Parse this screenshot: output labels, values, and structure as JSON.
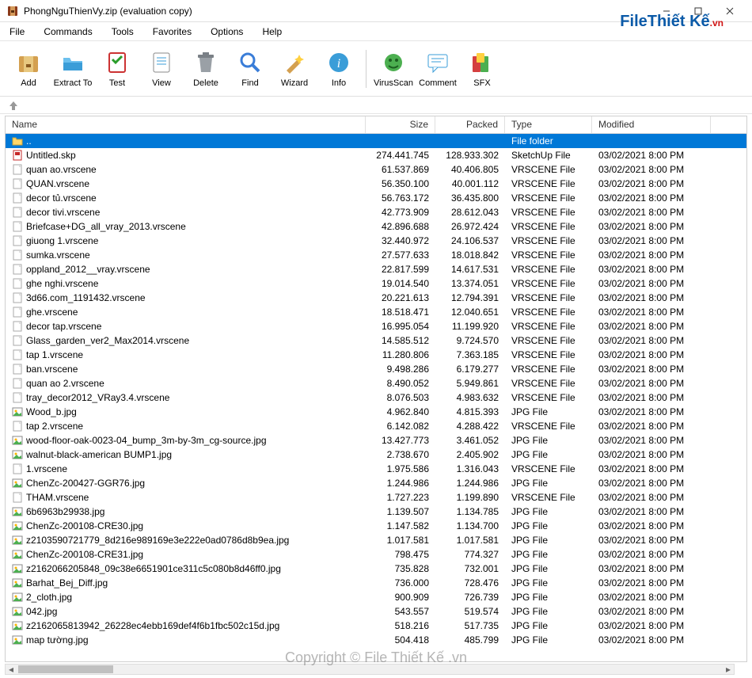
{
  "window": {
    "title": "PhongNguThienVy.zip (evaluation copy)"
  },
  "menu": [
    "File",
    "Commands",
    "Tools",
    "Favorites",
    "Options",
    "Help"
  ],
  "toolbar": [
    {
      "id": "add",
      "label": "Add"
    },
    {
      "id": "extract",
      "label": "Extract To"
    },
    {
      "id": "test",
      "label": "Test"
    },
    {
      "id": "view",
      "label": "View"
    },
    {
      "id": "delete",
      "label": "Delete"
    },
    {
      "id": "find",
      "label": "Find"
    },
    {
      "id": "wizard",
      "label": "Wizard"
    },
    {
      "id": "info",
      "label": "Info"
    },
    {
      "id": "sep"
    },
    {
      "id": "virus",
      "label": "VirusScan"
    },
    {
      "id": "comment",
      "label": "Comment"
    },
    {
      "id": "sfx",
      "label": "SFX"
    }
  ],
  "columns": {
    "name": "Name",
    "size": "Size",
    "packed": "Packed",
    "type": "Type",
    "modified": "Modified"
  },
  "parent_row": {
    "name": "..",
    "type": "File folder"
  },
  "files": [
    {
      "name": "Untitled.skp",
      "size": "274.441.745",
      "packed": "128.933.302",
      "type": "SketchUp File",
      "modified": "03/02/2021 8:00 PM",
      "icon": "skp"
    },
    {
      "name": "quan ao.vrscene",
      "size": "61.537.869",
      "packed": "40.406.805",
      "type": "VRSCENE File",
      "modified": "03/02/2021 8:00 PM",
      "icon": "doc"
    },
    {
      "name": "QUAN.vrscene",
      "size": "56.350.100",
      "packed": "40.001.112",
      "type": "VRSCENE File",
      "modified": "03/02/2021 8:00 PM",
      "icon": "doc"
    },
    {
      "name": "decor tủ.vrscene",
      "size": "56.763.172",
      "packed": "36.435.800",
      "type": "VRSCENE File",
      "modified": "03/02/2021 8:00 PM",
      "icon": "doc"
    },
    {
      "name": "decor tivi.vrscene",
      "size": "42.773.909",
      "packed": "28.612.043",
      "type": "VRSCENE File",
      "modified": "03/02/2021 8:00 PM",
      "icon": "doc"
    },
    {
      "name": "Briefcase+DG_all_vray_2013.vrscene",
      "size": "42.896.688",
      "packed": "26.972.424",
      "type": "VRSCENE File",
      "modified": "03/02/2021 8:00 PM",
      "icon": "doc"
    },
    {
      "name": "giuong 1.vrscene",
      "size": "32.440.972",
      "packed": "24.106.537",
      "type": "VRSCENE File",
      "modified": "03/02/2021 8:00 PM",
      "icon": "doc"
    },
    {
      "name": "sumka.vrscene",
      "size": "27.577.633",
      "packed": "18.018.842",
      "type": "VRSCENE File",
      "modified": "03/02/2021 8:00 PM",
      "icon": "doc"
    },
    {
      "name": "oppland_2012__vray.vrscene",
      "size": "22.817.599",
      "packed": "14.617.531",
      "type": "VRSCENE File",
      "modified": "03/02/2021 8:00 PM",
      "icon": "doc"
    },
    {
      "name": "ghe nghi.vrscene",
      "size": "19.014.540",
      "packed": "13.374.051",
      "type": "VRSCENE File",
      "modified": "03/02/2021 8:00 PM",
      "icon": "doc"
    },
    {
      "name": "3d66.com_1191432.vrscene",
      "size": "20.221.613",
      "packed": "12.794.391",
      "type": "VRSCENE File",
      "modified": "03/02/2021 8:00 PM",
      "icon": "doc"
    },
    {
      "name": "ghe.vrscene",
      "size": "18.518.471",
      "packed": "12.040.651",
      "type": "VRSCENE File",
      "modified": "03/02/2021 8:00 PM",
      "icon": "doc"
    },
    {
      "name": "decor tap.vrscene",
      "size": "16.995.054",
      "packed": "11.199.920",
      "type": "VRSCENE File",
      "modified": "03/02/2021 8:00 PM",
      "icon": "doc"
    },
    {
      "name": "Glass_garden_ver2_Max2014.vrscene",
      "size": "14.585.512",
      "packed": "9.724.570",
      "type": "VRSCENE File",
      "modified": "03/02/2021 8:00 PM",
      "icon": "doc"
    },
    {
      "name": "tap 1.vrscene",
      "size": "11.280.806",
      "packed": "7.363.185",
      "type": "VRSCENE File",
      "modified": "03/02/2021 8:00 PM",
      "icon": "doc"
    },
    {
      "name": "ban.vrscene",
      "size": "9.498.286",
      "packed": "6.179.277",
      "type": "VRSCENE File",
      "modified": "03/02/2021 8:00 PM",
      "icon": "doc"
    },
    {
      "name": "quan ao 2.vrscene",
      "size": "8.490.052",
      "packed": "5.949.861",
      "type": "VRSCENE File",
      "modified": "03/02/2021 8:00 PM",
      "icon": "doc"
    },
    {
      "name": "tray_decor2012_VRay3.4.vrscene",
      "size": "8.076.503",
      "packed": "4.983.632",
      "type": "VRSCENE File",
      "modified": "03/02/2021 8:00 PM",
      "icon": "doc"
    },
    {
      "name": "Wood_b.jpg",
      "size": "4.962.840",
      "packed": "4.815.393",
      "type": "JPG File",
      "modified": "03/02/2021 8:00 PM",
      "icon": "img"
    },
    {
      "name": "tap 2.vrscene",
      "size": "6.142.082",
      "packed": "4.288.422",
      "type": "VRSCENE File",
      "modified": "03/02/2021 8:00 PM",
      "icon": "doc"
    },
    {
      "name": "wood-floor-oak-0023-04_bump_3m-by-3m_cg-source.jpg",
      "size": "13.427.773",
      "packed": "3.461.052",
      "type": "JPG File",
      "modified": "03/02/2021 8:00 PM",
      "icon": "img"
    },
    {
      "name": "walnut-black-american BUMP1.jpg",
      "size": "2.738.670",
      "packed": "2.405.902",
      "type": "JPG File",
      "modified": "03/02/2021 8:00 PM",
      "icon": "img"
    },
    {
      "name": "1.vrscene",
      "size": "1.975.586",
      "packed": "1.316.043",
      "type": "VRSCENE File",
      "modified": "03/02/2021 8:00 PM",
      "icon": "doc"
    },
    {
      "name": "ChenZc-200427-GGR76.jpg",
      "size": "1.244.986",
      "packed": "1.244.986",
      "type": "JPG File",
      "modified": "03/02/2021 8:00 PM",
      "icon": "img"
    },
    {
      "name": "THAM.vrscene",
      "size": "1.727.223",
      "packed": "1.199.890",
      "type": "VRSCENE File",
      "modified": "03/02/2021 8:00 PM",
      "icon": "doc"
    },
    {
      "name": "6b6963b29938.jpg",
      "size": "1.139.507",
      "packed": "1.134.785",
      "type": "JPG File",
      "modified": "03/02/2021 8:00 PM",
      "icon": "img"
    },
    {
      "name": "ChenZc-200108-CRE30.jpg",
      "size": "1.147.582",
      "packed": "1.134.700",
      "type": "JPG File",
      "modified": "03/02/2021 8:00 PM",
      "icon": "img"
    },
    {
      "name": "z2103590721779_8d216e989169e3e222e0ad0786d8b9ea.jpg",
      "size": "1.017.581",
      "packed": "1.017.581",
      "type": "JPG File",
      "modified": "03/02/2021 8:00 PM",
      "icon": "img"
    },
    {
      "name": "ChenZc-200108-CRE31.jpg",
      "size": "798.475",
      "packed": "774.327",
      "type": "JPG File",
      "modified": "03/02/2021 8:00 PM",
      "icon": "img"
    },
    {
      "name": "z2162066205848_09c38e6651901ce311c5c080b8d46ff0.jpg",
      "size": "735.828",
      "packed": "732.001",
      "type": "JPG File",
      "modified": "03/02/2021 8:00 PM",
      "icon": "img"
    },
    {
      "name": "Barhat_Bej_Diff.jpg",
      "size": "736.000",
      "packed": "728.476",
      "type": "JPG File",
      "modified": "03/02/2021 8:00 PM",
      "icon": "img"
    },
    {
      "name": "2_cloth.jpg",
      "size": "900.909",
      "packed": "726.739",
      "type": "JPG File",
      "modified": "03/02/2021 8:00 PM",
      "icon": "img"
    },
    {
      "name": "042.jpg",
      "size": "543.557",
      "packed": "519.574",
      "type": "JPG File",
      "modified": "03/02/2021 8:00 PM",
      "icon": "img"
    },
    {
      "name": "z2162065813942_26228ec4ebb169def4f6b1fbc502c15d.jpg",
      "size": "518.216",
      "packed": "517.735",
      "type": "JPG File",
      "modified": "03/02/2021 8:00 PM",
      "icon": "img"
    },
    {
      "name": "map tường.jpg",
      "size": "504.418",
      "packed": "485.799",
      "type": "JPG File",
      "modified": "03/02/2021 8:00 PM",
      "icon": "img"
    }
  ],
  "watermark": "Copyright © File Thiết Kế .vn",
  "logo": {
    "brand": "File",
    "rest": "Thiết Kế",
    "vn": ".vn"
  }
}
